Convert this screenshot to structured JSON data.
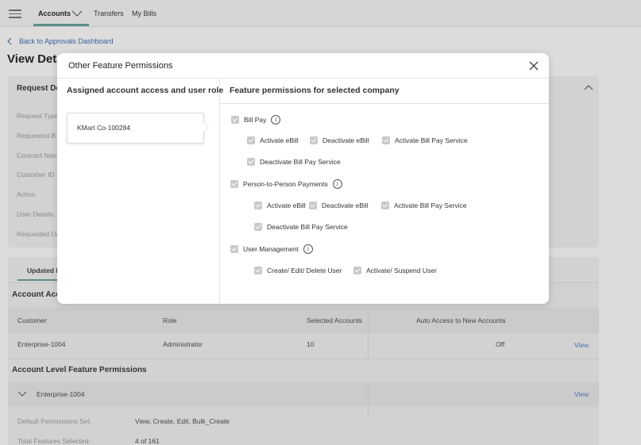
{
  "topnav": {
    "items": [
      {
        "label": "Accounts"
      },
      {
        "label": "Transfers"
      },
      {
        "label": "My Bills"
      }
    ]
  },
  "back_link": "Back to Approvals Dashboard",
  "page_title": "View Deta",
  "request_card": {
    "heading": "Request De",
    "labels": [
      "Request Type",
      "Requested B",
      "Contract Nam",
      "Customer ID",
      "Action",
      "User Details:",
      "Requested Da"
    ]
  },
  "tabs": {
    "updated": "Updated I"
  },
  "account_access": {
    "heading": "Account Acc",
    "columns": [
      "Customer",
      "Role",
      "Selected Accounts",
      "Auto Access to New Accounts"
    ],
    "rows": [
      {
        "customer": "Enterprise-1004",
        "role": "Administrator",
        "selected": "10",
        "auto": "Off",
        "action": "View"
      }
    ]
  },
  "feature_perms": {
    "heading": "Account Level Feature Permissions",
    "group": "Enterprise-1004",
    "group_action": "View",
    "default_label": "Default Permissions Set:",
    "default_value": "View, Create, Edit, Bulk_Create",
    "total_label": "Total Features Selected:",
    "total_value": "4 of 161"
  },
  "modal": {
    "title": "Other Feature Permissions",
    "left_heading": "Assigned account access and user role",
    "right_heading": "Feature permissions for selected company",
    "company": "KMart Co-100284",
    "info_glyph": "i",
    "groups": [
      {
        "label": "Bill Pay",
        "items": [
          "Activate eBill",
          "Deactivate eBill",
          "Activate Bill Pay Service",
          "Deactivate Bill Pay Service"
        ]
      },
      {
        "label": "Person-to-Person Payments",
        "items": [
          "Activate eBill",
          "Deactivate eBill",
          "Activate Bill Pay Service",
          "Deactivate Bill Pay Service"
        ]
      },
      {
        "label": "User Management",
        "items": [
          "Create/ Edit/ Delete User",
          "Activate/ Suspend User"
        ]
      }
    ]
  }
}
